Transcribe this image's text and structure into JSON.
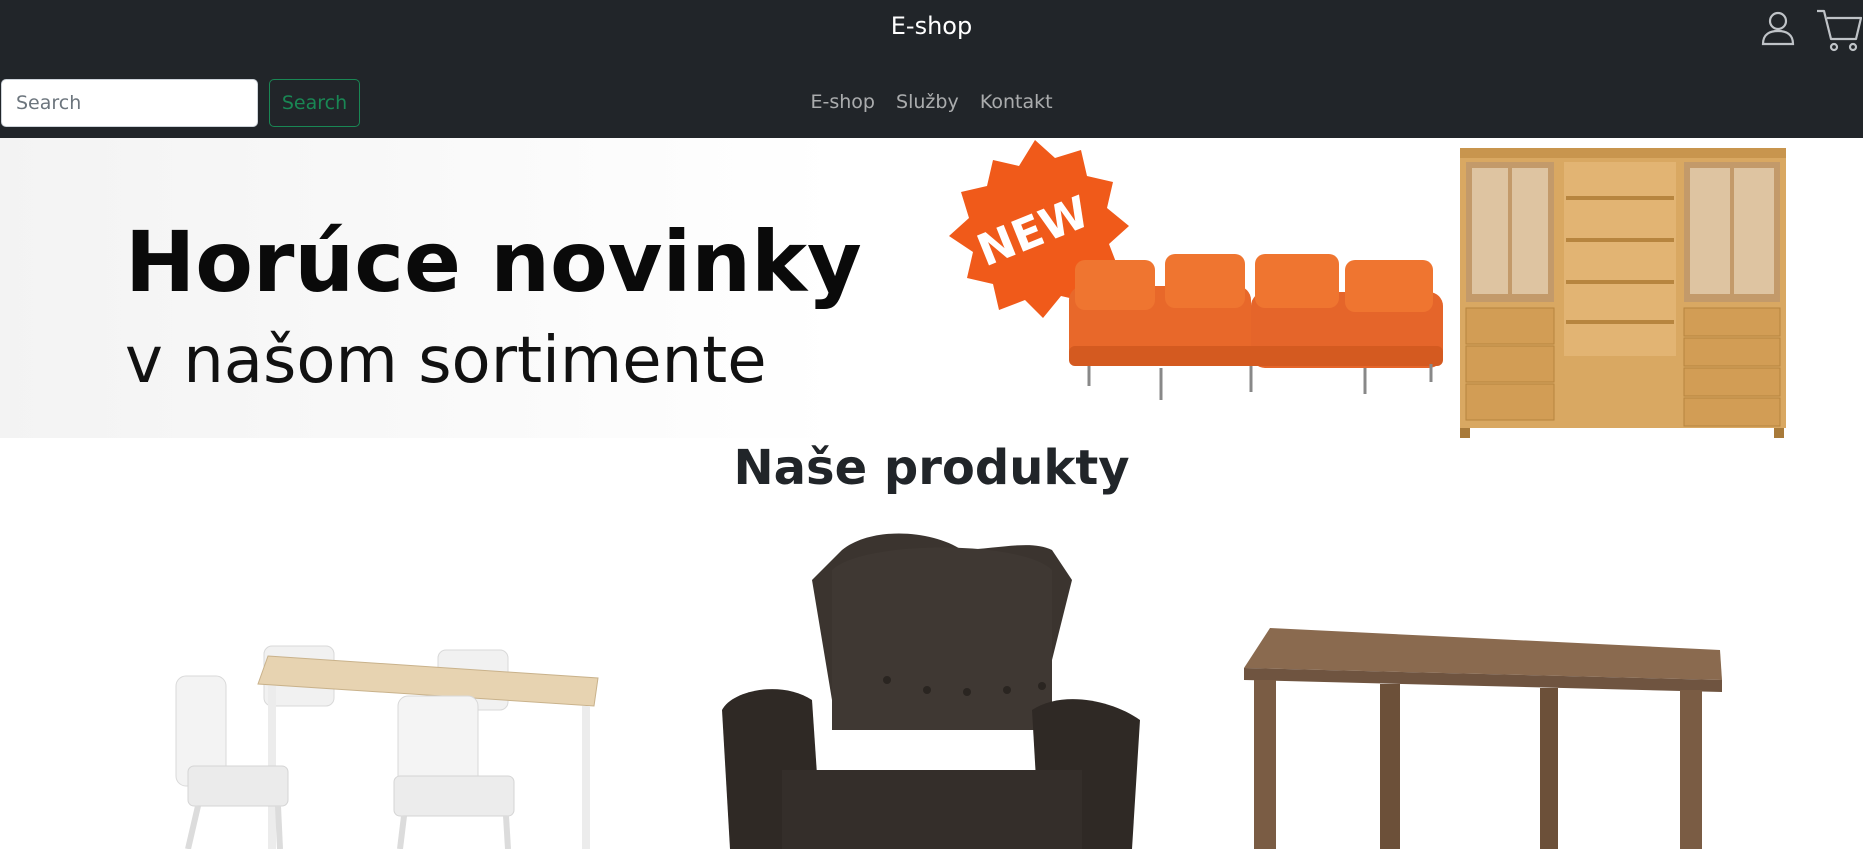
{
  "header": {
    "brand": "E-shop",
    "icons": [
      "user-icon",
      "cart-icon"
    ]
  },
  "search": {
    "placeholder": "Search",
    "value": "",
    "button_label": "Search"
  },
  "nav": {
    "items": [
      {
        "label": "E-shop"
      },
      {
        "label": "Služby"
      },
      {
        "label": "Kontakt"
      }
    ]
  },
  "banner": {
    "title": "Horúce novinky",
    "subtitle": "v našom sortimente",
    "badge": "NEW"
  },
  "products_section": {
    "title": "Naše produkty"
  },
  "colors": {
    "navbar_bg": "#212529",
    "search_button": "#198754",
    "badge": "#f05a1a"
  }
}
